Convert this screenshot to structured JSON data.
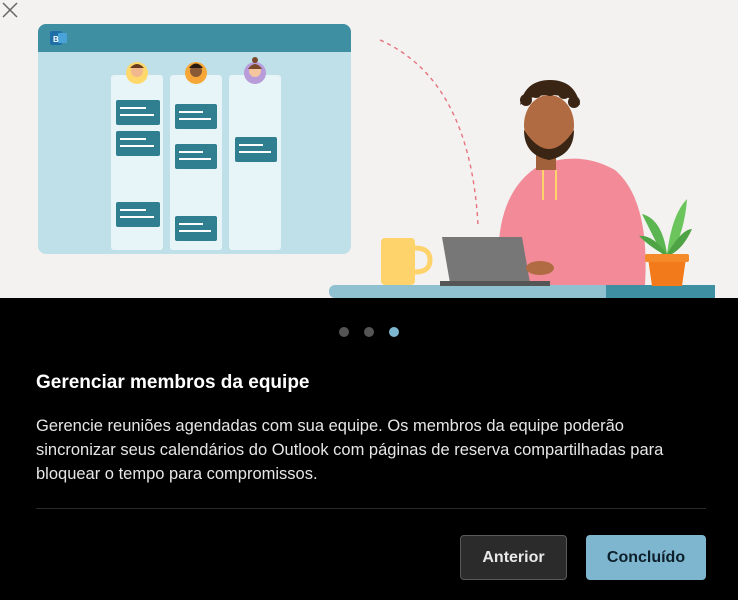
{
  "dialog": {
    "title": "Gerenciar membros da equipe",
    "description": "Gerencie reuniões agendadas com sua equipe. Os membros da equipe poderão sincronizar seus calendários do Outlook com páginas de reserva compartilhadas para bloquear o tempo para compromissos.",
    "close_icon": "close-icon",
    "pager": {
      "total": 3,
      "current": 3
    }
  },
  "buttons": {
    "previous_label": "Anterior",
    "done_label": "Concluído"
  },
  "colors": {
    "accent": "#7fb6cf",
    "panel_bg": "#000000",
    "hero_bg": "#f3f2f1"
  }
}
